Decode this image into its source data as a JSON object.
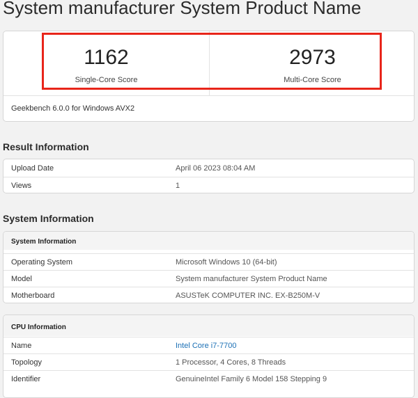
{
  "page": {
    "title": "System manufacturer System Product Name"
  },
  "scores": {
    "single": {
      "value": "1162",
      "label": "Single-Core Score"
    },
    "multi": {
      "value": "2973",
      "label": "Multi-Core Score"
    },
    "version": "Geekbench 6.0.0 for Windows AVX2"
  },
  "result_info": {
    "title": "Result Information",
    "rows": [
      {
        "key": "Upload Date",
        "value": "April 06 2023 08:04 AM"
      },
      {
        "key": "Views",
        "value": "1"
      }
    ]
  },
  "system_info": {
    "title": "System Information",
    "system_section": {
      "header": "System Information",
      "rows": [
        {
          "key": "Operating System",
          "value": "Microsoft Windows 10 (64-bit)"
        },
        {
          "key": "Model",
          "value": "System manufacturer System Product Name"
        },
        {
          "key": "Motherboard",
          "value": "ASUSTeK COMPUTER INC. EX-B250M-V"
        }
      ]
    },
    "cpu_section": {
      "header": "CPU Information",
      "rows": [
        {
          "key": "Name",
          "value": "Intel Core i7-7700"
        },
        {
          "key": "Topology",
          "value": "1 Processor, 4 Cores, 8 Threads"
        },
        {
          "key": "Identifier",
          "value": "GenuineIntel Family 6 Model 158 Stepping 9"
        }
      ]
    }
  },
  "colors": {
    "highlight": "#e8251a",
    "link": "#1a6fb5",
    "background": "#f2f2f2"
  }
}
